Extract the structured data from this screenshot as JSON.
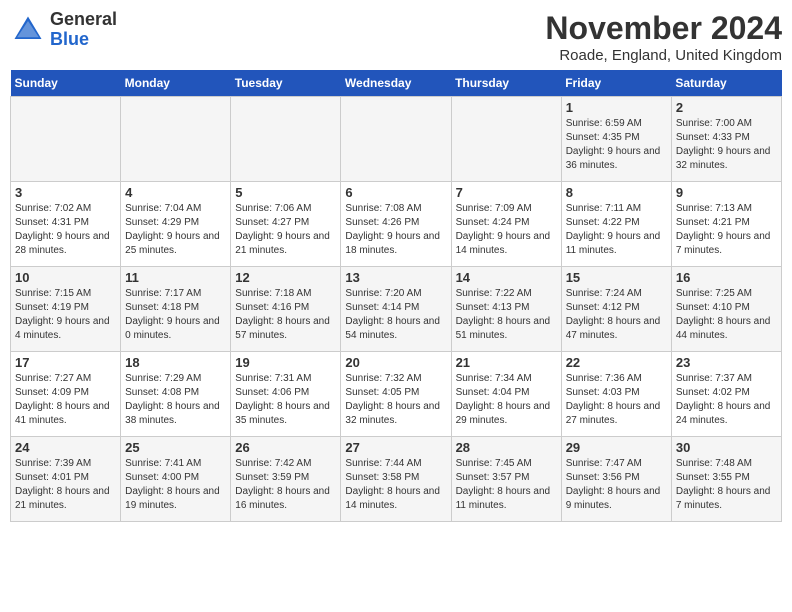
{
  "logo": {
    "general": "General",
    "blue": "Blue"
  },
  "title": "November 2024",
  "location": "Roade, England, United Kingdom",
  "weekdays": [
    "Sunday",
    "Monday",
    "Tuesday",
    "Wednesday",
    "Thursday",
    "Friday",
    "Saturday"
  ],
  "weeks": [
    [
      {
        "num": "",
        "info": ""
      },
      {
        "num": "",
        "info": ""
      },
      {
        "num": "",
        "info": ""
      },
      {
        "num": "",
        "info": ""
      },
      {
        "num": "",
        "info": ""
      },
      {
        "num": "1",
        "info": "Sunrise: 6:59 AM\nSunset: 4:35 PM\nDaylight: 9 hours and 36 minutes."
      },
      {
        "num": "2",
        "info": "Sunrise: 7:00 AM\nSunset: 4:33 PM\nDaylight: 9 hours and 32 minutes."
      }
    ],
    [
      {
        "num": "3",
        "info": "Sunrise: 7:02 AM\nSunset: 4:31 PM\nDaylight: 9 hours and 28 minutes."
      },
      {
        "num": "4",
        "info": "Sunrise: 7:04 AM\nSunset: 4:29 PM\nDaylight: 9 hours and 25 minutes."
      },
      {
        "num": "5",
        "info": "Sunrise: 7:06 AM\nSunset: 4:27 PM\nDaylight: 9 hours and 21 minutes."
      },
      {
        "num": "6",
        "info": "Sunrise: 7:08 AM\nSunset: 4:26 PM\nDaylight: 9 hours and 18 minutes."
      },
      {
        "num": "7",
        "info": "Sunrise: 7:09 AM\nSunset: 4:24 PM\nDaylight: 9 hours and 14 minutes."
      },
      {
        "num": "8",
        "info": "Sunrise: 7:11 AM\nSunset: 4:22 PM\nDaylight: 9 hours and 11 minutes."
      },
      {
        "num": "9",
        "info": "Sunrise: 7:13 AM\nSunset: 4:21 PM\nDaylight: 9 hours and 7 minutes."
      }
    ],
    [
      {
        "num": "10",
        "info": "Sunrise: 7:15 AM\nSunset: 4:19 PM\nDaylight: 9 hours and 4 minutes."
      },
      {
        "num": "11",
        "info": "Sunrise: 7:17 AM\nSunset: 4:18 PM\nDaylight: 9 hours and 0 minutes."
      },
      {
        "num": "12",
        "info": "Sunrise: 7:18 AM\nSunset: 4:16 PM\nDaylight: 8 hours and 57 minutes."
      },
      {
        "num": "13",
        "info": "Sunrise: 7:20 AM\nSunset: 4:14 PM\nDaylight: 8 hours and 54 minutes."
      },
      {
        "num": "14",
        "info": "Sunrise: 7:22 AM\nSunset: 4:13 PM\nDaylight: 8 hours and 51 minutes."
      },
      {
        "num": "15",
        "info": "Sunrise: 7:24 AM\nSunset: 4:12 PM\nDaylight: 8 hours and 47 minutes."
      },
      {
        "num": "16",
        "info": "Sunrise: 7:25 AM\nSunset: 4:10 PM\nDaylight: 8 hours and 44 minutes."
      }
    ],
    [
      {
        "num": "17",
        "info": "Sunrise: 7:27 AM\nSunset: 4:09 PM\nDaylight: 8 hours and 41 minutes."
      },
      {
        "num": "18",
        "info": "Sunrise: 7:29 AM\nSunset: 4:08 PM\nDaylight: 8 hours and 38 minutes."
      },
      {
        "num": "19",
        "info": "Sunrise: 7:31 AM\nSunset: 4:06 PM\nDaylight: 8 hours and 35 minutes."
      },
      {
        "num": "20",
        "info": "Sunrise: 7:32 AM\nSunset: 4:05 PM\nDaylight: 8 hours and 32 minutes."
      },
      {
        "num": "21",
        "info": "Sunrise: 7:34 AM\nSunset: 4:04 PM\nDaylight: 8 hours and 29 minutes."
      },
      {
        "num": "22",
        "info": "Sunrise: 7:36 AM\nSunset: 4:03 PM\nDaylight: 8 hours and 27 minutes."
      },
      {
        "num": "23",
        "info": "Sunrise: 7:37 AM\nSunset: 4:02 PM\nDaylight: 8 hours and 24 minutes."
      }
    ],
    [
      {
        "num": "24",
        "info": "Sunrise: 7:39 AM\nSunset: 4:01 PM\nDaylight: 8 hours and 21 minutes."
      },
      {
        "num": "25",
        "info": "Sunrise: 7:41 AM\nSunset: 4:00 PM\nDaylight: 8 hours and 19 minutes."
      },
      {
        "num": "26",
        "info": "Sunrise: 7:42 AM\nSunset: 3:59 PM\nDaylight: 8 hours and 16 minutes."
      },
      {
        "num": "27",
        "info": "Sunrise: 7:44 AM\nSunset: 3:58 PM\nDaylight: 8 hours and 14 minutes."
      },
      {
        "num": "28",
        "info": "Sunrise: 7:45 AM\nSunset: 3:57 PM\nDaylight: 8 hours and 11 minutes."
      },
      {
        "num": "29",
        "info": "Sunrise: 7:47 AM\nSunset: 3:56 PM\nDaylight: 8 hours and 9 minutes."
      },
      {
        "num": "30",
        "info": "Sunrise: 7:48 AM\nSunset: 3:55 PM\nDaylight: 8 hours and 7 minutes."
      }
    ]
  ]
}
